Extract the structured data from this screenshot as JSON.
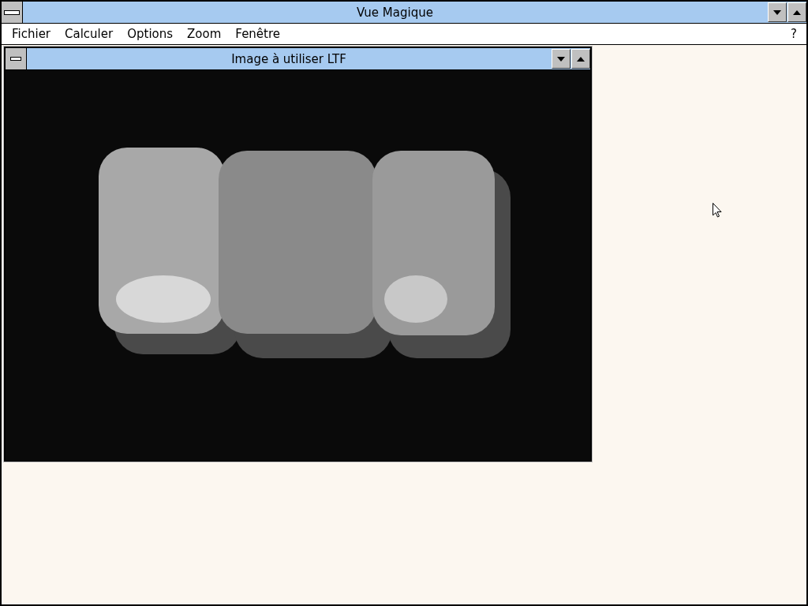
{
  "window": {
    "title": "Vue Magique"
  },
  "menu": [
    {
      "label": "Fichier"
    },
    {
      "label": "Calculer"
    },
    {
      "label": "Options"
    },
    {
      "label": "Zoom"
    },
    {
      "label": "Fenêtre"
    }
  ],
  "help_menu": {
    "label": "?"
  },
  "child_window": {
    "title": "Image à utiliser LTF"
  }
}
